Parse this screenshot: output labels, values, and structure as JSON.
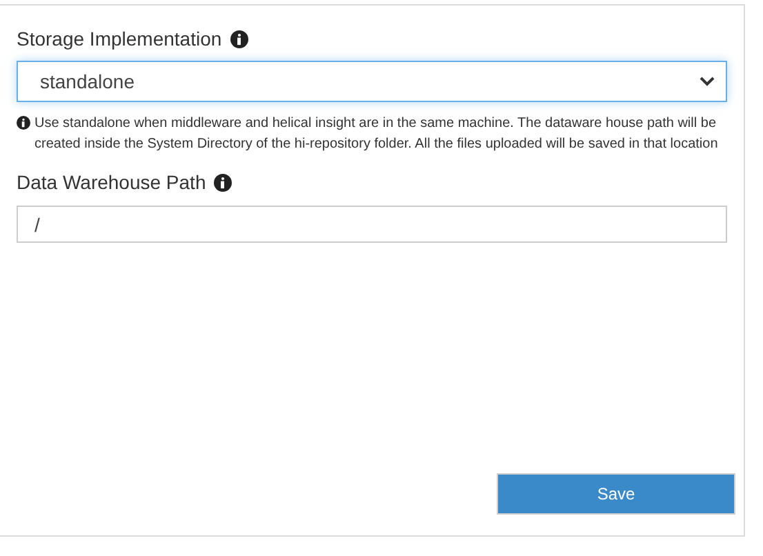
{
  "storage": {
    "label": "Storage Implementation",
    "value": "standalone",
    "help": "Use standalone when middleware and helical insight are in the same machine. The dataware house path will be created inside the System Directory of the hi-repository folder. All the files uploaded will be saved in that location"
  },
  "warehouse": {
    "label": "Data Warehouse Path",
    "value": "/"
  },
  "buttons": [
    "Save"
  ]
}
